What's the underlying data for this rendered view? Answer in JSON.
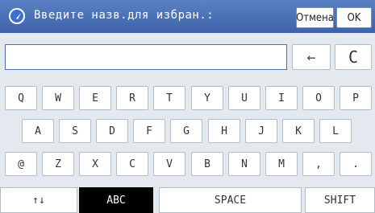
{
  "header": {
    "title": "Введите назв.для избран.:",
    "icon": "favorite-icon",
    "cancel_label": "Отмена",
    "ok_label": "OK"
  },
  "input": {
    "value": "",
    "placeholder": ""
  },
  "edit_keys": {
    "backspace": "←",
    "clear": "C"
  },
  "keyboard": {
    "row1": [
      "Q",
      "W",
      "E",
      "R",
      "T",
      "Y",
      "U",
      "I",
      "O",
      "P"
    ],
    "row2": [
      "A",
      "S",
      "D",
      "F",
      "G",
      "H",
      "J",
      "K",
      "L"
    ],
    "row3": [
      "@",
      "Z",
      "X",
      "C",
      "V",
      "B",
      "N",
      "M",
      ",",
      "."
    ],
    "bottom": {
      "toggle": "↑↓",
      "abc": "ABC",
      "space": "SPACE",
      "shift": "SHIFT"
    }
  },
  "colors": {
    "header": "#3d62a8",
    "keyboard_bg": "#e4e9f0",
    "active_mode": "#000000"
  }
}
